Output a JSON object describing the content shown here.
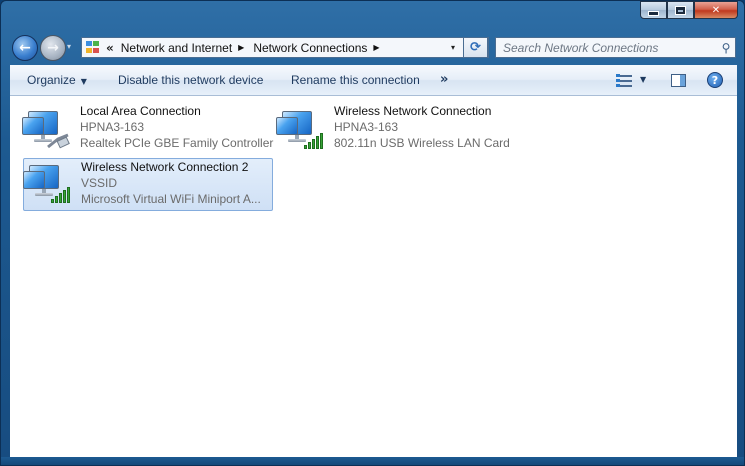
{
  "window": {
    "minimize_glyph": "minimize-icon",
    "maximize_glyph": "maximize-icon",
    "close_label": "✕"
  },
  "nav": {
    "back_icon": "back-arrow-icon",
    "forward_icon": "forward-arrow-icon",
    "recent_label": "▾"
  },
  "address": {
    "overflow": "«",
    "crumbs": [
      "Network and Internet",
      "Network Connections"
    ],
    "separator": "▶",
    "dropdown": "▾",
    "refresh": "⟳"
  },
  "search": {
    "placeholder": "Search Network Connections",
    "icon": "⚲"
  },
  "toolbar": {
    "organize": "Organize",
    "caret": "▼",
    "disable": "Disable this network device",
    "rename": "Rename this connection",
    "more": "»",
    "views_caret": "▼",
    "help": "?"
  },
  "connections": [
    {
      "name": "Local Area Connection",
      "network": "HPNA3-163",
      "adapter": "Realtek PCIe GBE Family Controller",
      "type": "wired",
      "selected": false
    },
    {
      "name": "Wireless Network Connection",
      "network": "HPNA3-163",
      "adapter": "802.11n USB Wireless LAN Card",
      "type": "wireless",
      "selected": false
    },
    {
      "name": "Wireless Network Connection 2",
      "network": "VSSID",
      "adapter": "Microsoft Virtual WiFi Miniport A...",
      "type": "wireless",
      "selected": true
    }
  ],
  "colors": {
    "accent": "#2f6fa7",
    "selection": "#cfe0f5",
    "signal": "#37a437"
  }
}
